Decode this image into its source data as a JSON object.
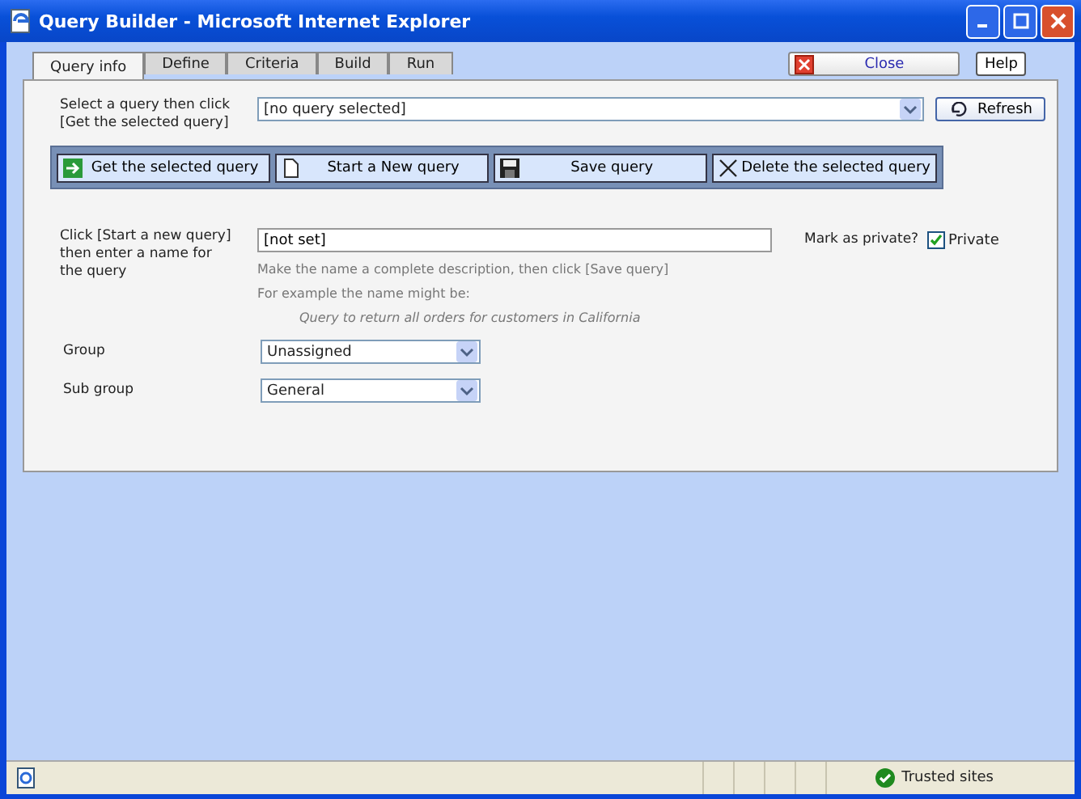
{
  "window": {
    "title": "Query Builder - Microsoft Internet Explorer"
  },
  "tabs": [
    {
      "label": "Query info",
      "selected": true
    },
    {
      "label": "Define",
      "selected": false
    },
    {
      "label": "Criteria",
      "selected": false
    },
    {
      "label": "Build",
      "selected": false
    },
    {
      "label": "Run",
      "selected": false
    }
  ],
  "close_button": "Close",
  "help_button": "Help",
  "query_select": {
    "label": "Select a query then click [Get the selected query]",
    "value": "[no query selected]"
  },
  "refresh_button": "Refresh",
  "toolbar": [
    {
      "kind": "get",
      "label": "Get the selected query"
    },
    {
      "kind": "new",
      "label": "Start a New query"
    },
    {
      "kind": "save",
      "label": "Save query"
    },
    {
      "kind": "delete",
      "label": "Delete the selected query"
    }
  ],
  "name_field": {
    "label": "Click [Start a new query] then enter a name for the query",
    "value": "[not set]",
    "hint": "Make the name a complete description, then click [Save query]",
    "example_intro": "For example the name might be:",
    "example": "Query to return all orders for customers in California"
  },
  "private": {
    "label": "Mark as private?",
    "checkbox_label": "Private",
    "checked": true
  },
  "group": {
    "label": "Group",
    "value": "Unassigned"
  },
  "sub_group": {
    "label": "Sub group",
    "value": "General"
  },
  "status_bar": {
    "zone": "Trusted sites"
  }
}
